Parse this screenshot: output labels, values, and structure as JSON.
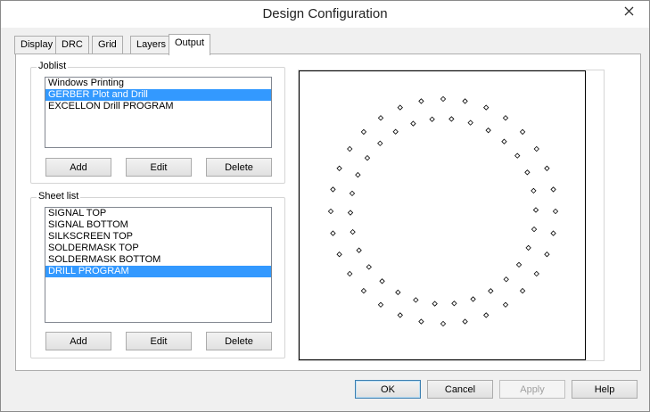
{
  "window": {
    "title": "Design Configuration"
  },
  "tabs": [
    {
      "label": "Display",
      "active": false
    },
    {
      "label": "DRC",
      "active": false
    },
    {
      "label": "Grid",
      "active": false
    },
    {
      "label": "Layers",
      "active": false
    },
    {
      "label": "Output",
      "active": true
    }
  ],
  "joblist": {
    "label": "Joblist",
    "items": [
      {
        "label": "Windows Printing",
        "selected": false
      },
      {
        "label": "GERBER Plot and Drill",
        "selected": true
      },
      {
        "label": "EXCELLON Drill PROGRAM",
        "selected": false
      }
    ],
    "buttons": {
      "add": "Add",
      "edit": "Edit",
      "delete": "Delete"
    }
  },
  "sheetlist": {
    "label": "Sheet list",
    "items": [
      {
        "label": "SIGNAL TOP",
        "selected": false
      },
      {
        "label": "SIGNAL BOTTOM",
        "selected": false
      },
      {
        "label": "SILKSCREEN TOP",
        "selected": false
      },
      {
        "label": "SOLDERMASK TOP",
        "selected": false
      },
      {
        "label": "SOLDERMASK BOTTOM",
        "selected": false
      },
      {
        "label": "DRILL PROGRAM",
        "selected": true
      }
    ],
    "buttons": {
      "add": "Add",
      "edit": "Edit",
      "delete": "Delete"
    }
  },
  "preview": {
    "description_icon": "drill-hole-marker",
    "outer_ring_holes": 32,
    "inner_ring_holes": 30
  },
  "footer": {
    "ok": "OK",
    "cancel": "Cancel",
    "apply": "Apply",
    "help": "Help"
  },
  "colors": {
    "selection": "#3399ff",
    "default_button_border": "#3c7fb1"
  },
  "icons": {
    "close": "close-icon"
  }
}
